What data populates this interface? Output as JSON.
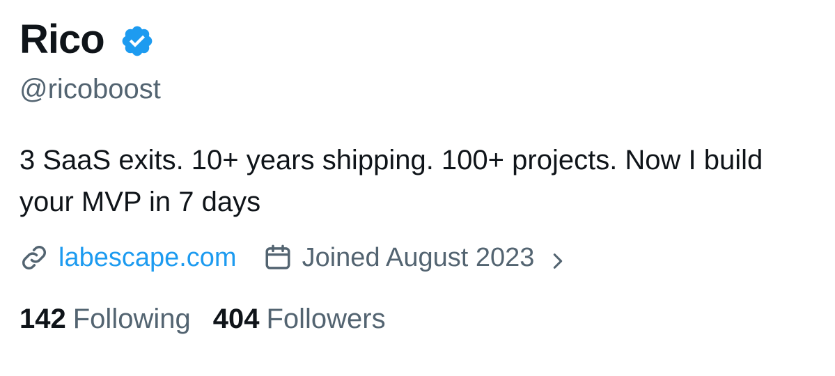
{
  "profile": {
    "display_name": "Rico",
    "handle": "@ricoboost",
    "bio": "3 SaaS exits. 10+ years shipping. 100+ projects. Now I build your MVP in 7 days",
    "website": "labescape.com",
    "joined": "Joined August 2023",
    "following_count": "142",
    "following_label": "Following",
    "followers_count": "404",
    "followers_label": "Followers"
  },
  "icons": {
    "verified": "verified-badge-icon",
    "link": "link-icon",
    "calendar": "calendar-icon",
    "chevron": "chevron-right-icon"
  },
  "colors": {
    "text_primary": "#0f1419",
    "text_secondary": "#536471",
    "accent": "#1d9bf0"
  }
}
